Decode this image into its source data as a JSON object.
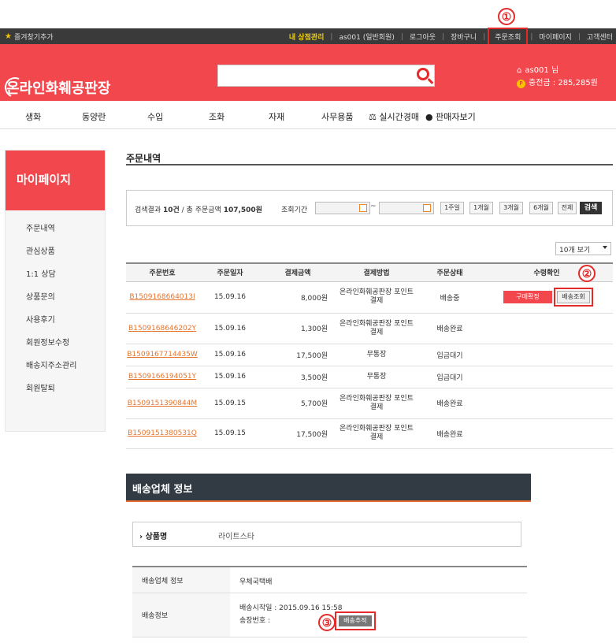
{
  "topbar": {
    "favorite": "즐겨찾기추가",
    "my_store": "내 상점관리",
    "user": "as001 (일반회원)",
    "logout": "로그아웃",
    "cart": "장바구니",
    "order_lookup": "주문조회",
    "mypage": "마이페이지",
    "support": "고객센터"
  },
  "annotations": {
    "one": "①",
    "two": "②",
    "three": "③"
  },
  "header": {
    "logo": "온라인화훼공판장",
    "search_placeholder": "",
    "username": "as001 님",
    "points": "충전금 : 285,285원",
    "coin_glyph": "P"
  },
  "catnav": {
    "items": [
      "생화",
      "동양란",
      "수입",
      "조화",
      "자재",
      "사무용품",
      "실시간경매",
      "판매자보기"
    ]
  },
  "sidebar": {
    "title": "마이페이지",
    "items": [
      "주문내역",
      "관심상품",
      "1:1 상담",
      "상품문의",
      "사용후기",
      "회원정보수정",
      "배송지주소관리",
      "회원탈퇴"
    ]
  },
  "main": {
    "title": "주문내역",
    "summary_prefix": "검색결과 ",
    "summary_count": "10건",
    "summary_mid": " / 총 주문금액 ",
    "summary_total": "107,500원",
    "period_label": "조회기간",
    "tilde": "~",
    "period_buttons": [
      "1주일",
      "1개월",
      "3개월",
      "6개월",
      "전체"
    ],
    "search_button": "검색",
    "per_page": "10개 보기"
  },
  "orders": {
    "headers": [
      "주문번호",
      "주문일자",
      "결제금액",
      "결제방법",
      "주문상태",
      "수령확인"
    ],
    "rows": [
      {
        "id": "B1509168664013I",
        "date": "15.09.16",
        "amount": "8,000원",
        "method": "온라인화훼공판장 포인트 결제",
        "status": "배송중",
        "confirm": "구매확정",
        "track": "배송조회"
      },
      {
        "id": "B1509168646202Y",
        "date": "15.09.16",
        "amount": "1,300원",
        "method": "온라인화훼공판장 포인트 결제",
        "status": "배송완료"
      },
      {
        "id": "B1509167714435W",
        "date": "15.09.16",
        "amount": "17,500원",
        "method": "무통장",
        "status": "입금대기"
      },
      {
        "id": "B1509166194051Y",
        "date": "15.09.16",
        "amount": "3,500원",
        "method": "무통장",
        "status": "입금대기"
      },
      {
        "id": "B1509151390844M",
        "date": "15.09.15",
        "amount": "5,700원",
        "method": "온라인화훼공판장 포인트 결제",
        "status": "배송완료"
      },
      {
        "id": "B1509151380531Q",
        "date": "15.09.15",
        "amount": "17,500원",
        "method": "온라인화훼공판장 포인트 결제",
        "status": "배송완료"
      }
    ]
  },
  "shipping": {
    "title": "배송업체 정보",
    "product_label": "상품명",
    "product_value": "라이트스타",
    "company_label": "배송업체 정보",
    "company_value": "우체국택배",
    "info_label": "배송정보",
    "start_text": "배송시작일 : 2015.09.16 15:58",
    "invoice_text": "송장번호 :",
    "track_button": "배송추적"
  }
}
